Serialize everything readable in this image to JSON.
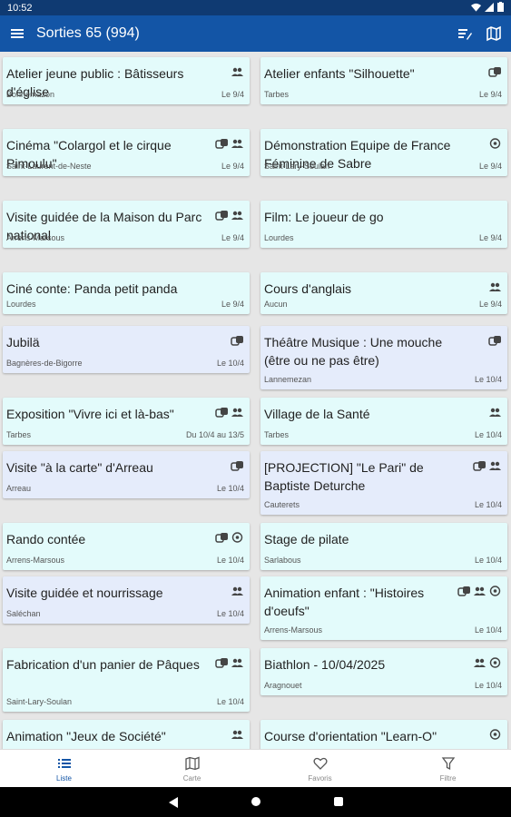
{
  "status": {
    "time": "10:52"
  },
  "app_bar": {
    "title": "Sorties 65 (994)"
  },
  "events": [
    {
      "title": "Atelier jeune public : Bâtisseurs d'église",
      "place": "Bonnemazon",
      "date": "Le 9/4",
      "icons": [
        "group-icon"
      ]
    },
    {
      "title": "Atelier enfants \"Silhouette\"",
      "place": "Tarbes",
      "date": "Le 9/4",
      "icons": [
        "culture-icon"
      ]
    },
    {
      "title": "Cinéma \"Colargol et le cirque Pimoulu\"",
      "place": "Saint-Laurent-de-Neste",
      "date": "Le 9/4",
      "icons": [
        "culture-icon",
        "group-icon"
      ]
    },
    {
      "title": "Démonstration Equipe de France Féminine de Sabre",
      "place": "Saint-Lary-Soulan",
      "date": "Le 9/4",
      "icons": [
        "sport-icon"
      ]
    },
    {
      "title": "Visite guidée de la Maison du Parc national",
      "place": "Arrens-Marsous",
      "date": "Le 9/4",
      "icons": [
        "culture-icon",
        "group-icon"
      ]
    },
    {
      "title": "Film: Le joueur de go",
      "place": "Lourdes",
      "date": "Le 9/4",
      "icons": []
    },
    {
      "title": "Ciné conte: Panda petit panda",
      "place": "Lourdes",
      "date": "Le 9/4",
      "icons": []
    },
    {
      "title": "Cours d'anglais",
      "place": "Aucun",
      "date": "Le 9/4",
      "icons": [
        "group-icon"
      ]
    },
    {
      "title": "Jubilä",
      "place": "Bagnères-de-Bigorre",
      "date": "Le 10/4",
      "icons": [
        "culture-icon"
      ]
    },
    {
      "title": "Théâtre Musique : Une mouche (être ou ne pas être)",
      "place": "Lannemezan",
      "date": "Le 10/4",
      "icons": [
        "culture-icon"
      ]
    },
    {
      "title": "Exposition \"Vivre ici et là-bas\"",
      "place": "Tarbes",
      "date": "Du 10/4 au 13/5",
      "icons": [
        "culture-icon",
        "group-icon"
      ]
    },
    {
      "title": "Village de la Santé",
      "place": "Tarbes",
      "date": "Le 10/4",
      "icons": [
        "group-icon"
      ]
    },
    {
      "title": "Visite \"à la carte\" d'Arreau",
      "place": "Arreau",
      "date": "Le 10/4",
      "icons": [
        "culture-icon"
      ]
    },
    {
      "title": "[PROJECTION] \"Le Pari\" de Baptiste Deturche",
      "place": "Cauterets",
      "date": "Le 10/4",
      "icons": [
        "culture-icon",
        "group-icon"
      ]
    },
    {
      "title": "Rando contée",
      "place": "Arrens-Marsous",
      "date": "Le 10/4",
      "icons": [
        "culture-icon",
        "sport-icon"
      ]
    },
    {
      "title": "Stage de pilate",
      "place": "Sarlabous",
      "date": "Le 10/4",
      "icons": []
    },
    {
      "title": "Visite guidée et nourrissage",
      "place": "Saléchan",
      "date": "Le 10/4",
      "icons": [
        "group-icon"
      ]
    },
    {
      "title": "Animation enfant : \"Histoires d'oeufs\"",
      "place": "Arrens-Marsous",
      "date": "Le 10/4",
      "icons": [
        "culture-icon",
        "group-icon",
        "sport-icon"
      ]
    },
    {
      "title": "Fabrication d'un panier de Pâques",
      "place": "Saint-Lary-Soulan",
      "date": "Le 10/4",
      "icons": [
        "culture-icon",
        "group-icon"
      ]
    },
    {
      "title": "Biathlon - 10/04/2025",
      "place": "Aragnouet",
      "date": "Le 10/4",
      "icons": [
        "group-icon",
        "sport-icon"
      ]
    },
    {
      "title": "Animation \"Jeux de Société\"",
      "place": "",
      "date": "",
      "icons": [
        "group-icon"
      ]
    },
    {
      "title": "Course d'orientation \"Learn-O\"",
      "place": "",
      "date": "",
      "icons": [
        "sport-icon"
      ]
    }
  ],
  "bottom_nav": {
    "liste": "Liste",
    "carte": "Carte",
    "favoris": "Favoris",
    "filtre": "Filtre"
  },
  "colors": {
    "app_bar": "#1355a6",
    "status_bar": "#0f3a72",
    "card_cyan": "#e3fbfb",
    "card_blue": "#e5ecfb"
  }
}
